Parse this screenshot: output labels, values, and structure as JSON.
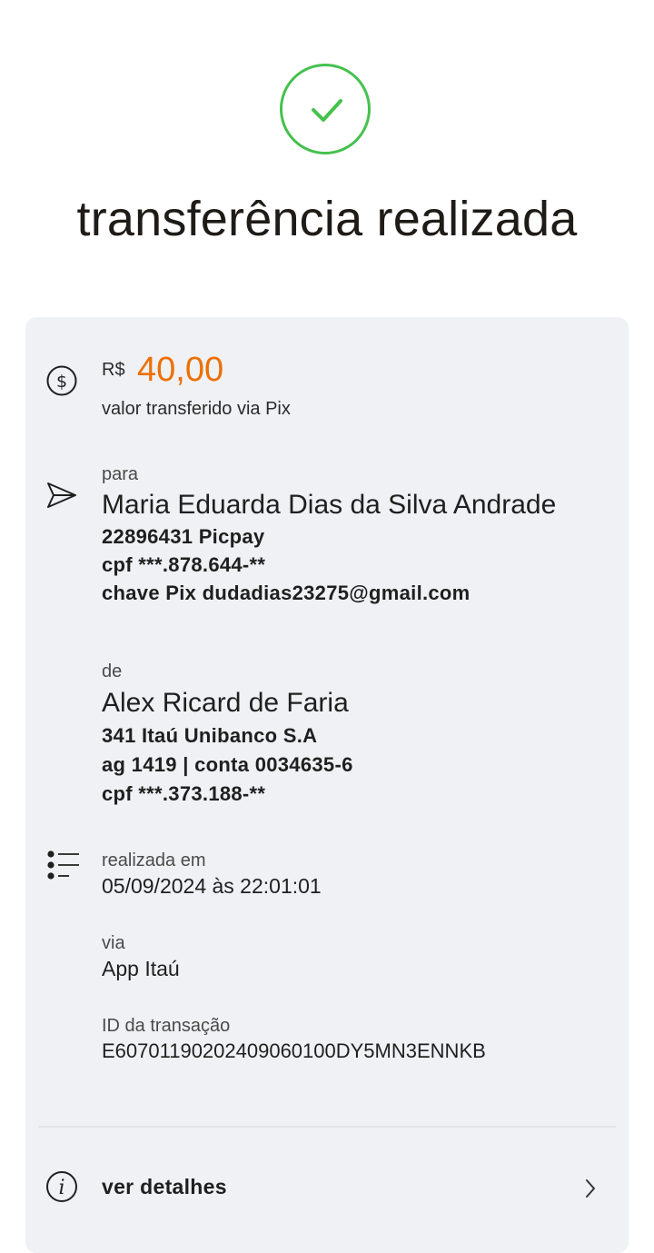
{
  "title": "transferência realizada",
  "amount": {
    "currency": "R$",
    "value": "40,00",
    "caption": "valor transferido via Pix"
  },
  "recipient": {
    "label": "para",
    "name": "Maria Eduarda Dias da Silva Andrade",
    "bank": "22896431 Picpay",
    "cpf": "cpf ***.878.644-**",
    "pix_key": "chave Pix dudadias23275@gmail.com"
  },
  "sender": {
    "label": "de",
    "name": "Alex Ricard de Faria",
    "bank": "341 Itaú Unibanco S.A",
    "account": "ag 1419 | conta 0034635-6",
    "cpf": "cpf ***.373.188-**"
  },
  "details": {
    "date_label": "realizada em",
    "date_value": "05/09/2024 às 22:01:01",
    "via_label": "via",
    "via_value": "App Itaú",
    "id_label": "ID da transação",
    "id_value": "E60701190202409060100DY5MN3ENNKB"
  },
  "footer": {
    "details_label": "ver detalhes"
  },
  "colors": {
    "success": "#45c14e",
    "amount": "#ec7000",
    "card_bg": "#eff1f4"
  },
  "icons": [
    "check-icon",
    "dollar-icon",
    "send-icon",
    "list-icon",
    "info-icon",
    "chevron-right-icon"
  ]
}
